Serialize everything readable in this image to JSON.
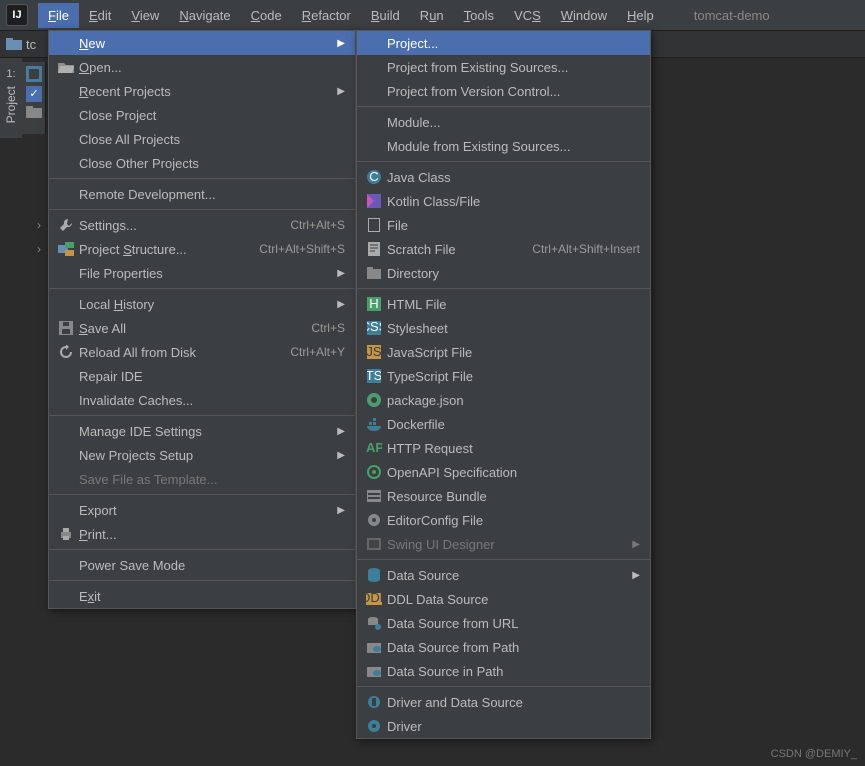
{
  "project_name": "tomcat-demo",
  "watermark": "CSDN @DEMIY_",
  "menubar": [
    "File",
    "Edit",
    "View",
    "Navigate",
    "Code",
    "Refactor",
    "Build",
    "Run",
    "Tools",
    "VCS",
    "Window",
    "Help"
  ],
  "menubar_u": [
    "F",
    "E",
    "V",
    "N",
    "C",
    "R",
    "B",
    "u",
    "T",
    "S",
    "W",
    "H"
  ],
  "sidebar": {
    "label": "Project",
    "badge": "1:"
  },
  "toolbar_folder": "tc",
  "file_menu": [
    {
      "type": "item",
      "label": "New",
      "u": "N",
      "icon": "",
      "arrow": true,
      "sel": true
    },
    {
      "type": "item",
      "label": "Open...",
      "u": "O",
      "icon": "folder-open"
    },
    {
      "type": "item",
      "label": "Recent Projects",
      "u": "R",
      "arrow": true
    },
    {
      "type": "item",
      "label": "Close Project"
    },
    {
      "type": "item",
      "label": "Close All Projects"
    },
    {
      "type": "item",
      "label": "Close Other Projects"
    },
    {
      "type": "sep"
    },
    {
      "type": "item",
      "label": "Remote Development..."
    },
    {
      "type": "sep"
    },
    {
      "type": "item",
      "label": "Settings...",
      "u": "T",
      "icon": "wrench",
      "short": "Ctrl+Alt+S",
      "chev": true
    },
    {
      "type": "item",
      "label": "Project Structure...",
      "u": "S",
      "icon": "structure",
      "short": "Ctrl+Alt+Shift+S",
      "chev": true
    },
    {
      "type": "item",
      "label": "File Properties",
      "arrow": true
    },
    {
      "type": "sep"
    },
    {
      "type": "item",
      "label": "Local History",
      "u": "H",
      "arrow": true
    },
    {
      "type": "item",
      "label": "Save All",
      "u": "S",
      "icon": "save",
      "short": "Ctrl+S"
    },
    {
      "type": "item",
      "label": "Reload All from Disk",
      "icon": "reload",
      "short": "Ctrl+Alt+Y"
    },
    {
      "type": "item",
      "label": "Repair IDE"
    },
    {
      "type": "item",
      "label": "Invalidate Caches..."
    },
    {
      "type": "sep"
    },
    {
      "type": "item",
      "label": "Manage IDE Settings",
      "arrow": true
    },
    {
      "type": "item",
      "label": "New Projects Setup",
      "arrow": true
    },
    {
      "type": "item",
      "label": "Save File as Template...",
      "dis": true
    },
    {
      "type": "sep"
    },
    {
      "type": "item",
      "label": "Export",
      "arrow": true
    },
    {
      "type": "item",
      "label": "Print...",
      "u": "P",
      "icon": "print"
    },
    {
      "type": "sep"
    },
    {
      "type": "item",
      "label": "Power Save Mode"
    },
    {
      "type": "sep"
    },
    {
      "type": "item",
      "label": "Exit",
      "u": "x"
    }
  ],
  "new_menu": [
    {
      "type": "item",
      "label": "Project...",
      "sel": true
    },
    {
      "type": "item",
      "label": "Project from Existing Sources..."
    },
    {
      "type": "item",
      "label": "Project from Version Control..."
    },
    {
      "type": "sep"
    },
    {
      "type": "item",
      "label": "Module..."
    },
    {
      "type": "item",
      "label": "Module from Existing Sources..."
    },
    {
      "type": "sep"
    },
    {
      "type": "item",
      "label": "Java Class",
      "icon": "java-class"
    },
    {
      "type": "item",
      "label": "Kotlin Class/File",
      "icon": "kotlin"
    },
    {
      "type": "item",
      "label": "File",
      "icon": "file"
    },
    {
      "type": "item",
      "label": "Scratch File",
      "icon": "scratch",
      "short": "Ctrl+Alt+Shift+Insert"
    },
    {
      "type": "item",
      "label": "Directory",
      "icon": "folder"
    },
    {
      "type": "sep"
    },
    {
      "type": "item",
      "label": "HTML File",
      "icon": "html"
    },
    {
      "type": "item",
      "label": "Stylesheet",
      "icon": "css"
    },
    {
      "type": "item",
      "label": "JavaScript File",
      "icon": "js"
    },
    {
      "type": "item",
      "label": "TypeScript File",
      "icon": "ts"
    },
    {
      "type": "item",
      "label": "package.json",
      "icon": "npm"
    },
    {
      "type": "item",
      "label": "Dockerfile",
      "icon": "docker"
    },
    {
      "type": "item",
      "label": "HTTP Request",
      "icon": "http"
    },
    {
      "type": "item",
      "label": "OpenAPI Specification",
      "icon": "openapi"
    },
    {
      "type": "item",
      "label": "Resource Bundle",
      "icon": "bundle"
    },
    {
      "type": "item",
      "label": "EditorConfig File",
      "icon": "gear"
    },
    {
      "type": "item",
      "label": "Swing UI Designer",
      "icon": "swing",
      "dis": true,
      "arrow": true
    },
    {
      "type": "sep"
    },
    {
      "type": "item",
      "label": "Data Source",
      "icon": "db",
      "arrow": true
    },
    {
      "type": "item",
      "label": "DDL Data Source",
      "icon": "ddl"
    },
    {
      "type": "item",
      "label": "Data Source from URL",
      "icon": "db-url"
    },
    {
      "type": "item",
      "label": "Data Source from Path",
      "icon": "db-path"
    },
    {
      "type": "item",
      "label": "Data Source in Path",
      "icon": "db-in"
    },
    {
      "type": "sep"
    },
    {
      "type": "item",
      "label": "Driver and Data Source",
      "icon": "driver-ds"
    },
    {
      "type": "item",
      "label": "Driver",
      "icon": "driver"
    }
  ]
}
